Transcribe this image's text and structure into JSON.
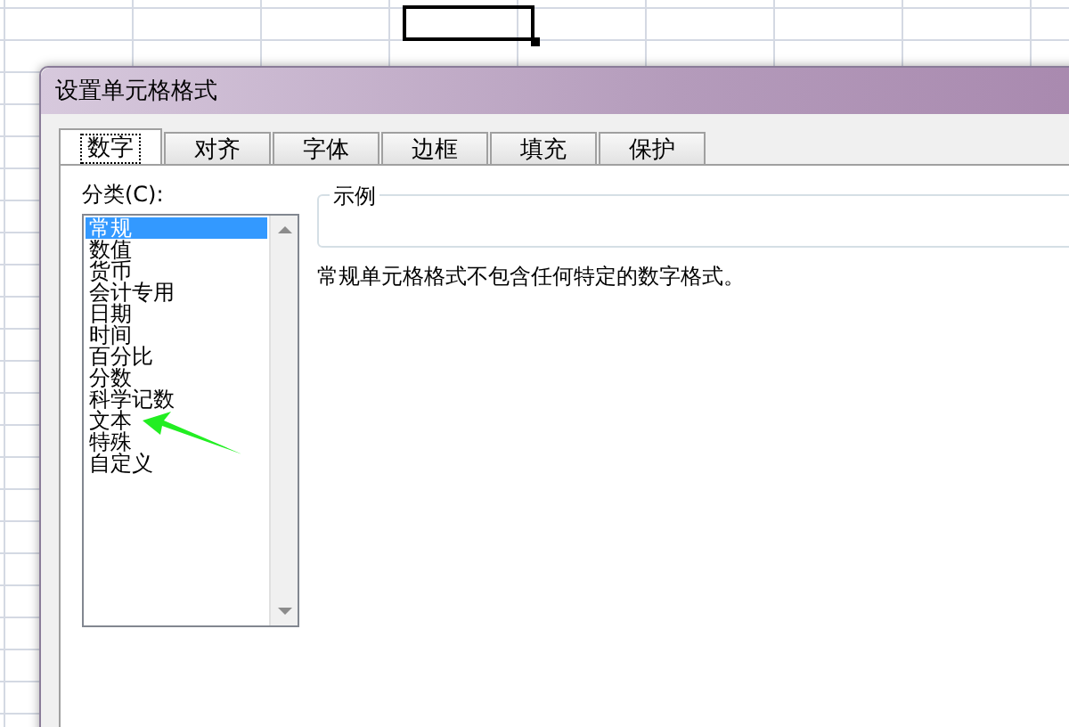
{
  "dialog": {
    "title": "设置单元格格式",
    "tabs": [
      {
        "label": "数字",
        "selected": true
      },
      {
        "label": "对齐",
        "selected": false
      },
      {
        "label": "字体",
        "selected": false
      },
      {
        "label": "边框",
        "selected": false
      },
      {
        "label": "填充",
        "selected": false
      },
      {
        "label": "保护",
        "selected": false
      }
    ],
    "category_label": "分类(C):",
    "categories": [
      {
        "label": "常规",
        "selected": true
      },
      {
        "label": "数值",
        "selected": false
      },
      {
        "label": "货币",
        "selected": false
      },
      {
        "label": "会计专用",
        "selected": false
      },
      {
        "label": "日期",
        "selected": false
      },
      {
        "label": "时间",
        "selected": false
      },
      {
        "label": "百分比",
        "selected": false
      },
      {
        "label": "分数",
        "selected": false
      },
      {
        "label": "科学记数",
        "selected": false
      },
      {
        "label": "文本",
        "selected": false
      },
      {
        "label": "特殊",
        "selected": false
      },
      {
        "label": "自定义",
        "selected": false
      }
    ],
    "sample_legend": "示例",
    "description": "常规单元格格式不包含任何特定的数字格式。"
  }
}
